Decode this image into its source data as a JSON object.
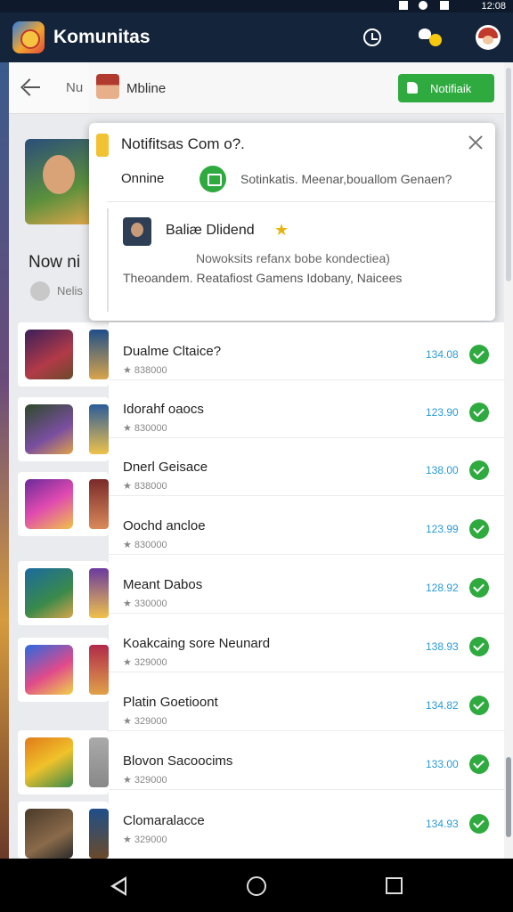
{
  "status_bar": {
    "time": "12:08"
  },
  "app_bar": {
    "title": "Komunitas"
  },
  "background_page": {
    "header_text": "Nu",
    "heading": "Now ni",
    "sub": "Nelis"
  },
  "card_header": {
    "label": "Mbline",
    "notify_button": "Notifiaik"
  },
  "popup": {
    "title": "Notifitsas Com o?.",
    "status": "Onnine",
    "question": "Sotinkatis. Meenar,bouallom Genaen?",
    "user_name": "Baliæ Dlidend",
    "star": "★",
    "line1": "Nowoksits refanx bobe kondectiea)",
    "line2": "Theoandem. Reatafiost Gamens Idobany, Naicees"
  },
  "list": {
    "items": [
      {
        "name": "Dualme Cltaice?",
        "sub": "★ 838000",
        "value": "134.08"
      },
      {
        "name": "Idorahf oaocs",
        "sub": "★ 830000",
        "value": "123.90"
      },
      {
        "name": "Dnerl Geisace",
        "sub": "★ 838000",
        "value": "138.00"
      },
      {
        "name": "Oochd ancloe",
        "sub": "★ 830000",
        "value": "123.99"
      },
      {
        "name": "Meant Dabos",
        "sub": "★ 330000",
        "value": "128.92"
      },
      {
        "name": "Koakcaing sore Neunard",
        "sub": "★ 329000",
        "value": "138.93"
      },
      {
        "name": "Platin Goetioont",
        "sub": "★ 329000",
        "value": "134.82"
      },
      {
        "name": "Blovon Sacoocims",
        "sub": "★ 329000",
        "value": "133.00"
      },
      {
        "name": "Clomaralacce",
        "sub": "★ 329000",
        "value": "134.93"
      }
    ]
  },
  "colors": {
    "app_bar": "#14243a",
    "accent_green": "#2eaa3f",
    "value_blue": "#2a9ad8"
  },
  "icons": [
    "clock-icon",
    "notification-icon",
    "profile-avatar-icon",
    "back-arrow-icon",
    "close-icon",
    "chat-icon",
    "star-icon",
    "check-icon",
    "nav-back-icon",
    "nav-home-icon",
    "nav-recents-icon"
  ]
}
